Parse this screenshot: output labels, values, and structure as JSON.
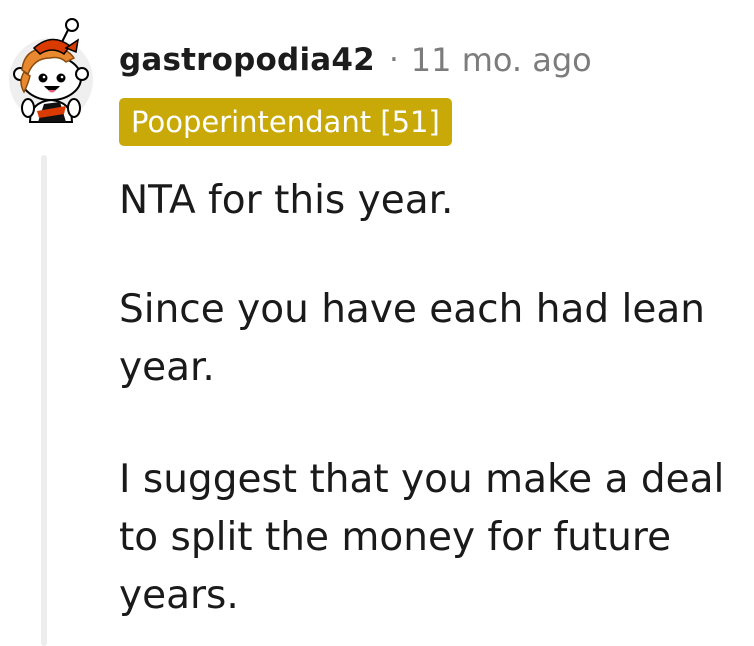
{
  "comment": {
    "author": "gastropodia42",
    "separator": "·",
    "timestamp": "11 mo. ago",
    "flair": "Pooperintendant [51]",
    "flair_color": "#c8a908",
    "avatar_icon": "snoo-avatar-icon",
    "paragraphs": [
      "NTA for this year.",
      "Since you have each had lean year.",
      "I suggest that you make a deal to split the money for future years."
    ]
  }
}
